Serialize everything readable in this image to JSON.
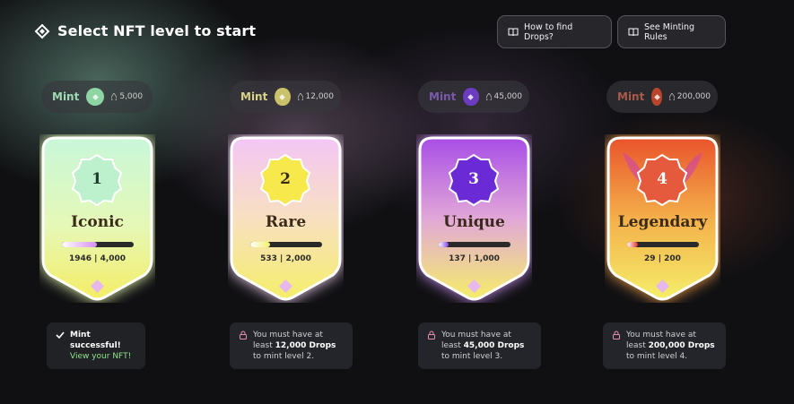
{
  "header": {
    "title": "Select NFT level to start"
  },
  "top_buttons": {
    "how_to": "How to find Drops?",
    "rules": "See Minting Rules"
  },
  "levels": [
    {
      "number": "1",
      "name": "Iconic",
      "mint_label": "Mint",
      "price": "5,000",
      "current": "1946",
      "target": "4,000",
      "progress": 0.49,
      "bar_color": "#d58ff0",
      "info_line1": "Mint successful!",
      "info_link": "View your NFT!",
      "colors": {
        "top": "#c8f7d9",
        "bottom": "#f4ed66",
        "badge": "#bdf0cd",
        "accent": "#9fe3b1"
      }
    },
    {
      "number": "2",
      "name": "Rare",
      "mint_label": "Mint",
      "price": "12,000",
      "current": "533",
      "target": "2,000",
      "progress": 0.27,
      "bar_color": "#f3f06a",
      "info_a": "You must have at least ",
      "info_b": "12,000 Drops",
      "info_c": " to mint level 2.",
      "colors": {
        "top": "#f4c6f6",
        "bottom": "#f5ee6a",
        "badge": "#f7e84c",
        "accent": "#f4d3f6"
      }
    },
    {
      "number": "3",
      "name": "Unique",
      "mint_label": "Mint",
      "price": "45,000",
      "current": "137",
      "target": "1,000",
      "progress": 0.14,
      "bar_color": "#8a45e8",
      "info_a": "You must have at least ",
      "info_b": "45,000 Drops",
      "info_c": " to mint level 3.",
      "colors": {
        "top": "#b15be7",
        "bottom": "#f5ee6a",
        "badge": "#6a2ad6",
        "accent": "#c58cf0"
      }
    },
    {
      "number": "4",
      "name": "Legendary",
      "mint_label": "Mint",
      "price": "200,000",
      "current": "29",
      "target": "200",
      "progress": 0.15,
      "bar_color": "#e8302a",
      "info_a": "You must have at least ",
      "info_b": "200,000 Drops",
      "info_c": " to mint level 4.",
      "colors": {
        "top": "#e9542c",
        "bottom": "#f5ee6a",
        "badge": "#e55a3c",
        "accent": "#f08a5a"
      }
    }
  ],
  "icons": {
    "logo": "drops-logo-icon",
    "book": "book-icon",
    "coin": "drop-coin-icon",
    "check": "check-icon",
    "lock": "lock-icon",
    "gem": "gem-icon"
  }
}
